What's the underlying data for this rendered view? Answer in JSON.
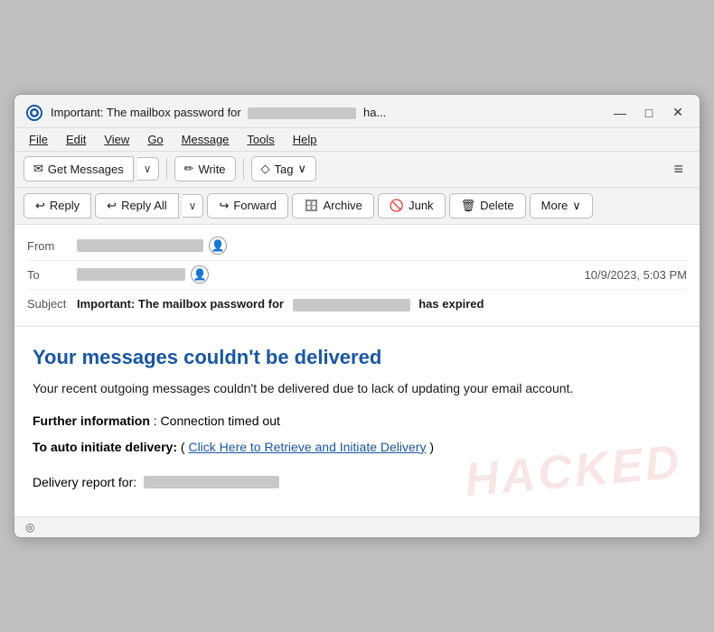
{
  "window": {
    "title_prefix": "Important: The mailbox password for",
    "title_suffix": "ha...",
    "redact_placeholder": "████████████",
    "controls": {
      "minimize": "—",
      "maximize": "□",
      "close": "✕"
    }
  },
  "menu": {
    "items": [
      "File",
      "Edit",
      "View",
      "Go",
      "Message",
      "Tools",
      "Help"
    ]
  },
  "toolbar": {
    "get_messages_label": "Get Messages",
    "write_label": "Write",
    "tag_label": "Tag",
    "dropdown_arrow": "∨",
    "hamburger": "≡"
  },
  "action_bar": {
    "reply_label": "Reply",
    "reply_all_label": "Reply All",
    "forward_label": "Forward",
    "archive_label": "Archive",
    "junk_label": "Junk",
    "delete_label": "Delete",
    "more_label": "More",
    "split_arrow": "∨"
  },
  "email": {
    "from_label": "From",
    "to_label": "To",
    "subject_label": "Subject",
    "subject_bold": "Important: The mailbox password for",
    "subject_suffix": "has expired",
    "timestamp": "10/9/2023, 5:03 PM",
    "heading": "Your messages couldn't be delivered",
    "para1": "Your recent outgoing messages couldn't be delivered due to lack of updating your email account.",
    "further_label": "Further information",
    "further_value": ": Connection timed out",
    "auto_label": "To auto initiate delivery:",
    "auto_prefix": " (",
    "link_text": "Click Here to Retrieve and Initiate Delivery",
    "auto_suffix": ")",
    "delivery_label": "Delivery report for:",
    "watermark": "HACKED"
  },
  "status_bar": {
    "icon": "◎",
    "text": ""
  },
  "colors": {
    "link": "#1a56a0",
    "heading": "#1a56a0",
    "redact": "#c8c8c8",
    "watermark": "rgba(200,50,50,0.12)"
  }
}
